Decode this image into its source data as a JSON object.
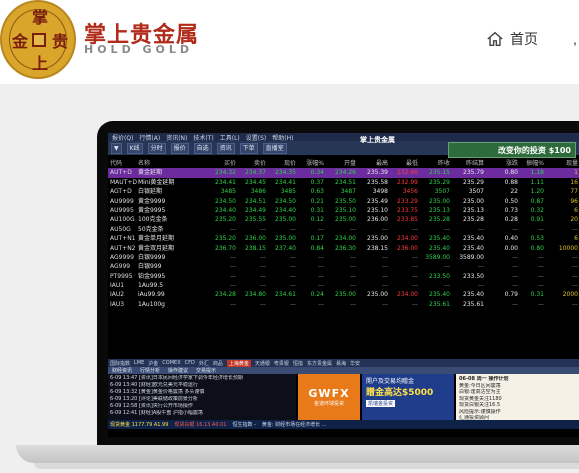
{
  "header": {
    "coin_chars": [
      "掌",
      "金",
      "贵",
      "上"
    ],
    "brand_cn": "掌上贵金属",
    "brand_en": "HOLD GOLD",
    "nav_home_label": "首页",
    "nav_more": ","
  },
  "screen": {
    "app_logo": "掌上贵金属",
    "menu": [
      "报价(Q)",
      "行情(A)",
      "资讯(N)",
      "技术(T)",
      "工具(L)",
      "设置(S)",
      "帮助(H)"
    ],
    "toolbar": [
      "▼",
      "K线",
      "分时",
      "报价",
      "自选",
      "资讯",
      "下单",
      "直播室"
    ],
    "ad_banner": "改变你的投资 $100",
    "columns": [
      "代码",
      "名称",
      "买价",
      "卖价",
      "现价",
      "涨幅%",
      "开盘",
      "最高",
      "最低",
      "昨收",
      "昨结算",
      "涨跌",
      "振幅%",
      "现量"
    ],
    "rows": [
      {
        "code": "AUT+D",
        "name": "黄金延期",
        "vals": [
          "234.32",
          "234.37",
          "234.35",
          "0.34",
          "234.26",
          "235.39",
          "232.60",
          "235.15",
          "235.79",
          "0.80",
          "1.18",
          "1"
        ]
      },
      {
        "code": "MAUT+D",
        "name": "Mini黄金延期",
        "vals": [
          "234.41",
          "234.45",
          "234.41",
          "0.37",
          "234.51",
          "235.58",
          "232.99",
          "235.29",
          "235.29",
          "0.88",
          "1.11",
          "16"
        ]
      },
      {
        "code": "AGT+D",
        "name": "白银延期",
        "vals": [
          "3485",
          "3486",
          "3485",
          "0.63",
          "3487",
          "3498",
          "3456",
          "3507",
          "3507",
          "22",
          "1.20",
          "77"
        ]
      },
      {
        "code": "AU9999",
        "name": "黄金9999",
        "vals": [
          "234.50",
          "234.51",
          "234.50",
          "0.21",
          "235.50",
          "235.49",
          "233.29",
          "235.00",
          "235.00",
          "0.50",
          "0.87",
          "96"
        ]
      },
      {
        "code": "AU9995",
        "name": "黄金9995",
        "vals": [
          "234.40",
          "234.49",
          "234.40",
          "0.31",
          "235.10",
          "235.10",
          "233.75",
          "235.13",
          "235.13",
          "0.73",
          "0.32",
          "6"
        ]
      },
      {
        "code": "AU100G",
        "name": "100克金条",
        "vals": [
          "235.20",
          "235.55",
          "235.00",
          "0.12",
          "235.00",
          "236.00",
          "233.85",
          "235.28",
          "235.28",
          "0.28",
          "0.91",
          "20"
        ]
      },
      {
        "code": "AU50G",
        "name": "50克金条",
        "vals": [
          "",
          "",
          "",
          "",
          "",
          "",
          "",
          "",
          "",
          "",
          "",
          ""
        ]
      },
      {
        "code": "AUT+N1",
        "name": "黄金单月延期",
        "vals": [
          "235.20",
          "236.00",
          "235.00",
          "0.17",
          "234.00",
          "235.00",
          "234.00",
          "235.40",
          "235.40",
          "0.40",
          "0.53",
          "6"
        ]
      },
      {
        "code": "AUT+N2",
        "name": "黄金双月延期",
        "vals": [
          "236.70",
          "238.15",
          "237.40",
          "0.84",
          "236.30",
          "238.15",
          "236.00",
          "235.40",
          "235.40",
          "0.00",
          "0.80",
          "10000"
        ]
      },
      {
        "code": "AG9999",
        "name": "白银9999",
        "vals": [
          "",
          "",
          "",
          "",
          "",
          "",
          "",
          "3589.00",
          "3589.00",
          "",
          "",
          ""
        ]
      },
      {
        "code": "AG999",
        "name": "白银999",
        "vals": [
          "",
          "",
          "",
          "",
          "",
          "",
          "",
          "",
          "",
          "",
          "",
          ""
        ]
      },
      {
        "code": "PT9995",
        "name": "铂金9995",
        "vals": [
          "",
          "",
          "",
          "",
          "",
          "",
          "",
          "233.50",
          "233.50",
          "",
          "",
          ""
        ]
      },
      {
        "code": "IAU1",
        "name": "1Au99.5",
        "vals": [
          "",
          "",
          "",
          "",
          "",
          "",
          "",
          "",
          "",
          "",
          "",
          ""
        ]
      },
      {
        "code": "IAU2",
        "name": "iAu99.99",
        "vals": [
          "234.28",
          "234.80",
          "234.61",
          "0.24",
          "235.00",
          "235.00",
          "234.00",
          "235.40",
          "235.40",
          "0.79",
          "0.31",
          "2000"
        ]
      },
      {
        "code": "IAU3",
        "name": "1Au100g",
        "vals": [
          "",
          "",
          "",
          "",
          "",
          "",
          "",
          "235.61",
          "235.61",
          "",
          "",
          ""
        ]
      }
    ],
    "tabs": [
      "国际指数",
      "LME",
      "沪金",
      "COMEX",
      "CFD",
      "外汇",
      "商品",
      "上海黄金",
      "天通银",
      "粤贵银",
      "恒指",
      "东方贵金属",
      "易海",
      "华安"
    ],
    "active_tab": "上海黄金",
    "news_tabs": [
      "财经资讯",
      "行情分析",
      "操作建议",
      "交易提示"
    ],
    "news": [
      "6-09 13:47 [资讯]日本民间经济学家下调今年经济增长预期",
      "6-09 13:40 [财经]欧元兑美元平稳运行",
      "6-09 13:32 [黄金]黄金价格震荡 多头谨慎",
      "6-09 13:20 [评论]美联储政策前景分析",
      "6-09 12:58 [资讯]央行公开市场操作",
      "6-09 12:41 [财经]A股午盘 沪指小幅震荡"
    ],
    "ad1_big": "GWFX",
    "ad1_small": "金道环球投资",
    "ad2_title": "開户及交易均贈金",
    "ad2_amount": "贈金高达$5000",
    "ad2_brand": "凯瑞金投资",
    "side_title": "06-08 周一 操作计划",
    "side_items": [
      "黄金:今日区间震荡",
      "白银:逢高沽空为主",
      "现货黄金关注1180",
      "现货白银关注16.5",
      "风险提示:谨慎操作",
      "汇通投资顾问"
    ],
    "status": [
      {
        "label": "现货黄金",
        "value": "1177.79 A1.99",
        "cls": "hl"
      },
      {
        "label": "现货白银",
        "value": "16.13 A0.01",
        "cls": "rd"
      },
      {
        "label": "",
        "value": "恒生指数 -",
        "cls": ""
      },
      {
        "label": "",
        "value": "黄金: 财经市场在经济增长 ...",
        "cls": ""
      }
    ]
  }
}
